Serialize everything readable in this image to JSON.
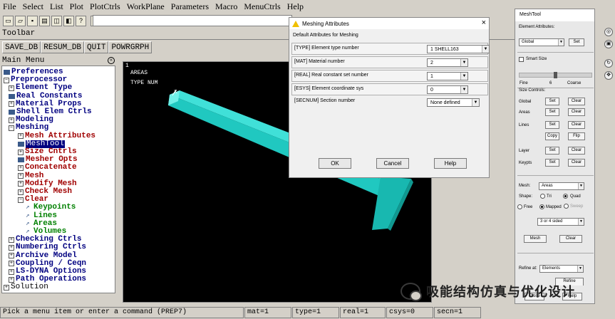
{
  "menubar": [
    "File",
    "Select",
    "List",
    "Plot",
    "PlotCtrls",
    "WorkPlane",
    "Parameters",
    "Macro",
    "MenuCtrls",
    "Help"
  ],
  "toolbar": {
    "label": "Toolbar",
    "buttons": [
      "SAVE_DB",
      "RESUM_DB",
      "QUIT",
      "POWRGRPH"
    ]
  },
  "main_menu": {
    "title": "Main Menu",
    "items": [
      {
        "label": "Preferences",
        "exp": "■",
        "style": "blue",
        "level": 0
      },
      {
        "label": "Preprocessor",
        "exp": "⊟",
        "style": "blue",
        "level": 0
      },
      {
        "label": "Element Type",
        "exp": "⊞",
        "style": "blue",
        "level": 1
      },
      {
        "label": "Real Constants",
        "exp": "■",
        "style": "blue",
        "level": 1
      },
      {
        "label": "Material Props",
        "exp": "⊞",
        "style": "blue",
        "level": 1
      },
      {
        "label": "Shell Elem Ctrls",
        "exp": "■",
        "style": "blue",
        "level": 1
      },
      {
        "label": "Modeling",
        "exp": "⊞",
        "style": "blue",
        "level": 1
      },
      {
        "label": "Meshing",
        "exp": "⊟",
        "style": "blue",
        "level": 1
      },
      {
        "label": "Mesh Attributes",
        "exp": "⊞",
        "style": "red",
        "level": 2
      },
      {
        "label": "MeshTool",
        "exp": "■",
        "style": "selected",
        "level": 2
      },
      {
        "label": "Size Cntrls",
        "exp": "⊞",
        "style": "red",
        "level": 2
      },
      {
        "label": "Mesher Opts",
        "exp": "■",
        "style": "red",
        "level": 2
      },
      {
        "label": "Concatenate",
        "exp": "⊞",
        "style": "red",
        "level": 2
      },
      {
        "label": "Mesh",
        "exp": "⊞",
        "style": "red",
        "level": 2
      },
      {
        "label": "Modify Mesh",
        "exp": "⊞",
        "style": "red",
        "level": 2
      },
      {
        "label": "Check Mesh",
        "exp": "⊞",
        "style": "red",
        "level": 2
      },
      {
        "label": "Clear",
        "exp": "⊟",
        "style": "red",
        "level": 2
      },
      {
        "label": "Keypoints",
        "exp": "↗",
        "style": "green",
        "level": 3
      },
      {
        "label": "Lines",
        "exp": "↗",
        "style": "green",
        "level": 3
      },
      {
        "label": "Areas",
        "exp": "↗",
        "style": "green",
        "level": 3
      },
      {
        "label": "Volumes",
        "exp": "↗",
        "style": "green",
        "level": 3
      },
      {
        "label": "Checking Ctrls",
        "exp": "⊞",
        "style": "blue",
        "level": 1
      },
      {
        "label": "Numbering Ctrls",
        "exp": "⊞",
        "style": "blue",
        "level": 1
      },
      {
        "label": "Archive Model",
        "exp": "⊞",
        "style": "blue",
        "level": 1
      },
      {
        "label": "Coupling / Ceqn",
        "exp": "⊞",
        "style": "blue",
        "level": 1
      },
      {
        "label": "LS-DYNA Options",
        "exp": "⊞",
        "style": "blue",
        "level": 1
      },
      {
        "label": "Path Operations",
        "exp": "⊞",
        "style": "blue",
        "level": 1
      },
      {
        "label": "Solution",
        "exp": "⊞",
        "style": "black",
        "level": 0
      }
    ]
  },
  "graphics": {
    "window_number": "1",
    "line1": "AREAS",
    "line2": "TYPE NUM",
    "axis_label": "X"
  },
  "dialog": {
    "title": "Meshing Attributes",
    "close": "×",
    "subtitle": "Default Attributes for Meshing",
    "rows": [
      {
        "label": "[TYPE]  Element type number",
        "value": "1    SHELL163"
      },
      {
        "label": "[MAT]   Material number",
        "value": "2"
      },
      {
        "label": "[REAL]  Real constant set number",
        "value": "1"
      },
      {
        "label": "[ESYS]  Element coordinate sys",
        "value": "0"
      },
      {
        "label": "[SECNUM]  Section number",
        "value": "None defined"
      }
    ],
    "buttons": {
      "ok": "OK",
      "cancel": "Cancel",
      "help": "Help"
    }
  },
  "meshtool": {
    "title": "MeshTool",
    "element_attributes": "Element Attributes:",
    "attr_select": "Global",
    "set": "Set",
    "smart_size": "Smart Size",
    "fine": "Fine",
    "size_value": "6",
    "coarse": "Coarse",
    "slider_level": 0.5,
    "size_controls": "Size Controls:",
    "global": "Global",
    "areas": "Areas",
    "lines": "Lines",
    "layer": "Layer",
    "keypts": "Keypts",
    "clear": "Clear",
    "copy": "Copy",
    "flip": "Flip",
    "mesh_label": "Mesh:",
    "mesh_select": "Areas",
    "shape": "Shape:",
    "tri": "Tri",
    "quad": "Quad",
    "free": "Free",
    "mapped": "Mapped",
    "sweep": "Sweep",
    "sided_select": "3 or 4 sided",
    "mesh_btn": "Mesh",
    "clear_btn": "Clear",
    "refine_at": "Refine at:",
    "refine_select": "Elements",
    "refine_btn": "Refine",
    "close_btn": "Close",
    "help_btn": "Help"
  },
  "watermark": "吸能结构仿真与优化设计",
  "statusbar": {
    "prompt": "Pick a menu item or enter a command (PREP7)",
    "mat": "mat=1",
    "type": "type=1",
    "real": "real=1",
    "csys": "csys=0",
    "secn": "secn=1"
  }
}
